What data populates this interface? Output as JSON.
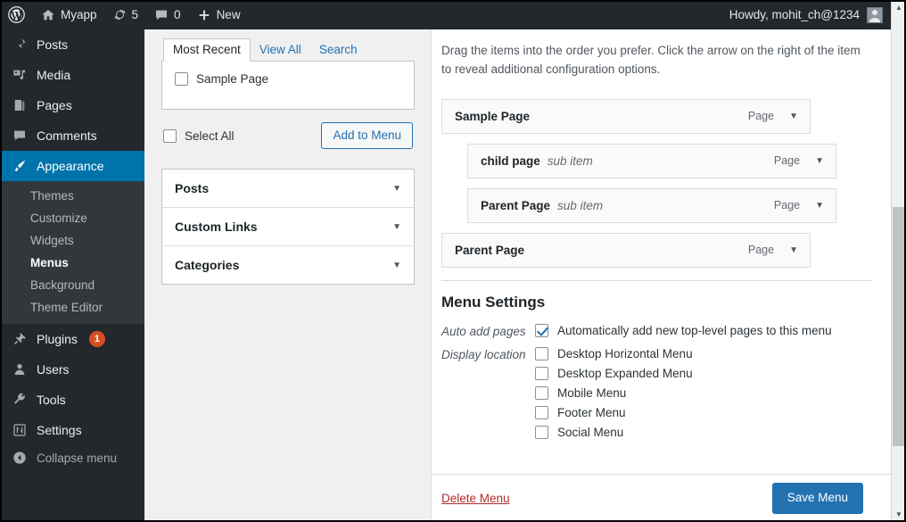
{
  "adminbar": {
    "wp_logo_icon": "wordpress-logo-icon",
    "site": {
      "icon": "home-icon",
      "label": "Myapp"
    },
    "updates": {
      "icon": "updates-refresh-icon",
      "count": "5"
    },
    "comments": {
      "icon": "comment-bubble-icon",
      "count": "0"
    },
    "new": {
      "icon": "plus-icon",
      "label": "New"
    },
    "howdy": "Howdy, mohit_ch@1234",
    "avatar_icon": "user-avatar-icon"
  },
  "sidebar": {
    "items": [
      {
        "label": "Posts",
        "icon": "pin-icon"
      },
      {
        "label": "Media",
        "icon": "media-icon"
      },
      {
        "label": "Pages",
        "icon": "pages-icon"
      },
      {
        "label": "Comments",
        "icon": "comment-icon"
      },
      {
        "label": "Appearance",
        "icon": "paintbrush-icon",
        "current": true
      }
    ],
    "submenu": [
      {
        "label": "Themes"
      },
      {
        "label": "Customize"
      },
      {
        "label": "Widgets"
      },
      {
        "label": "Menus",
        "current": true
      },
      {
        "label": "Background"
      },
      {
        "label": "Theme Editor"
      }
    ],
    "items_lower": [
      {
        "label": "Plugins",
        "icon": "plug-icon",
        "badge": "1"
      },
      {
        "label": "Users",
        "icon": "user-icon"
      },
      {
        "label": "Tools",
        "icon": "wrench-icon"
      },
      {
        "label": "Settings",
        "icon": "sliders-icon"
      }
    ],
    "collapse": {
      "label": "Collapse menu",
      "icon": "collapse-arrow-icon"
    }
  },
  "add_items_panel": {
    "tabs": [
      {
        "label": "Most Recent",
        "active": true
      },
      {
        "label": "View All",
        "active": false
      },
      {
        "label": "Search",
        "active": false
      }
    ],
    "pages": [
      {
        "label": "Sample Page",
        "checked": false
      }
    ],
    "select_all_label": "Select All",
    "select_all_checked": false,
    "add_to_menu_label": "Add to Menu",
    "accordion": [
      {
        "label": "Posts",
        "icon": "chevron-down-icon"
      },
      {
        "label": "Custom Links",
        "icon": "chevron-down-icon"
      },
      {
        "label": "Categories",
        "icon": "chevron-down-icon"
      }
    ]
  },
  "menu_structure": {
    "instructions": "Drag the items into the order you prefer. Click the arrow on the right of the item to reveal additional configuration options.",
    "items": [
      {
        "title": "Sample Page",
        "sub": "",
        "type": "Page",
        "depth": 0
      },
      {
        "title": "child page",
        "sub": "sub item",
        "type": "Page",
        "depth": 1
      },
      {
        "title": "Parent Page",
        "sub": "sub item",
        "type": "Page",
        "depth": 1
      },
      {
        "title": "Parent Page",
        "sub": "",
        "type": "Page",
        "depth": 0
      }
    ]
  },
  "menu_settings": {
    "heading": "Menu Settings",
    "auto_add_label": "Auto add pages",
    "auto_add_option": "Automatically add new top-level pages to this menu",
    "auto_add_checked": true,
    "display_location_label": "Display location",
    "locations": [
      {
        "label": "Desktop Horizontal Menu",
        "checked": false
      },
      {
        "label": "Desktop Expanded Menu",
        "checked": false
      },
      {
        "label": "Mobile Menu",
        "checked": false
      },
      {
        "label": "Footer Menu",
        "checked": false
      },
      {
        "label": "Social Menu",
        "checked": false
      }
    ]
  },
  "footer_actions": {
    "delete_label": "Delete Menu",
    "save_label": "Save Menu"
  },
  "scrollbar": {
    "up_icon": "scroll-up-arrow-icon",
    "down_icon": "scroll-down-arrow-icon"
  },
  "colors": {
    "admin_bar": "#23282d",
    "sidebar": "#23282d",
    "accent": "#2271b1",
    "current": "#0073aa",
    "badge": "#d54e21",
    "danger": "#b32d2e"
  }
}
